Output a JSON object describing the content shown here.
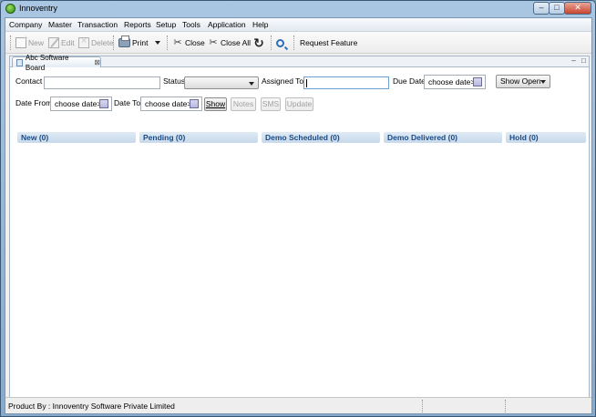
{
  "window": {
    "title": "Innoventry",
    "controls": {
      "minimize": "–",
      "maximize": "□",
      "close": "✕"
    }
  },
  "menubar": [
    "Company",
    "Master",
    "Transaction",
    "Reports",
    "Setup",
    "Tools",
    "Application",
    "Help"
  ],
  "toolbar": {
    "new": "New",
    "edit": "Edit",
    "delete": "Delete",
    "print": "Print",
    "close": "Close",
    "close_all": "Close All",
    "request_feature": "Request Feature"
  },
  "editor": {
    "tab_label": "Abc Software Board",
    "tab_close": "⊠"
  },
  "filters": {
    "contact_label": "Contact",
    "contact_value": "",
    "status_label": "Status",
    "status_value": "",
    "assigned_to_label": "Assigned To",
    "assigned_to_value": "",
    "due_date_label": "Due Date",
    "due_date_value": "choose date>",
    "show_open": "Show Open",
    "date_from_label": "Date From",
    "date_from_value": "choose date>",
    "date_to_label": "Date To",
    "date_to_value": "choose date>",
    "show_button": "Show",
    "notes_button": "Notes",
    "sms_button": "SMS",
    "update_button": "Update"
  },
  "columns": [
    "New (0)",
    "Pending (0)",
    "Demo Scheduled (0)",
    "Demo Delivered (0)",
    "Hold (0)"
  ],
  "scrollbar": {
    "left_arrow": "◄",
    "right_arrow": "►",
    "grip": "|||"
  },
  "status_bar": {
    "text": "Product By : Innoventry Software Private Limited"
  }
}
